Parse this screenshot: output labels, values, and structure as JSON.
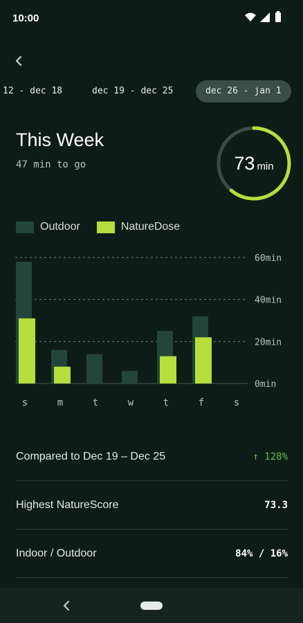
{
  "status": {
    "time": "10:00"
  },
  "tabs": [
    {
      "label": "12 - dec 18",
      "active": false
    },
    {
      "label": "dec 19 - dec 25",
      "active": false
    },
    {
      "label": "dec 26 - jan 1",
      "active": true
    }
  ],
  "summary": {
    "title": "This Week",
    "subtitle": "47 min to go",
    "ring_value": "73",
    "ring_unit": "min",
    "ring_progress": 0.61
  },
  "colors": {
    "outdoor": "#24453a",
    "naturedose": "#b6de3c",
    "ring_track": "#3c4a46",
    "background": "#0e1c18"
  },
  "legend": {
    "outdoor": "Outdoor",
    "naturedose": "NatureDose"
  },
  "chart_data": {
    "type": "bar",
    "categories": [
      "s",
      "m",
      "t",
      "w",
      "t",
      "f",
      "s"
    ],
    "series": [
      {
        "name": "Outdoor",
        "values": [
          58,
          16,
          14,
          6,
          25,
          32,
          0
        ]
      },
      {
        "name": "NatureDose",
        "values": [
          31,
          8,
          0,
          0,
          13,
          22,
          0
        ]
      }
    ],
    "y_ticks": [
      "0min",
      "20min",
      "40min",
      "60min"
    ],
    "ylim": [
      0,
      60
    ],
    "grid": "dashed horizontal",
    "legend_position": "top-left"
  },
  "stats": [
    {
      "label": "Compared to Dec 19 – Dec 25",
      "value": "↑ 128%",
      "trend": "up"
    },
    {
      "label": "Highest NatureScore",
      "value": "73.3"
    },
    {
      "label": "Indoor / Outdoor",
      "value": "84% / 16%"
    }
  ]
}
